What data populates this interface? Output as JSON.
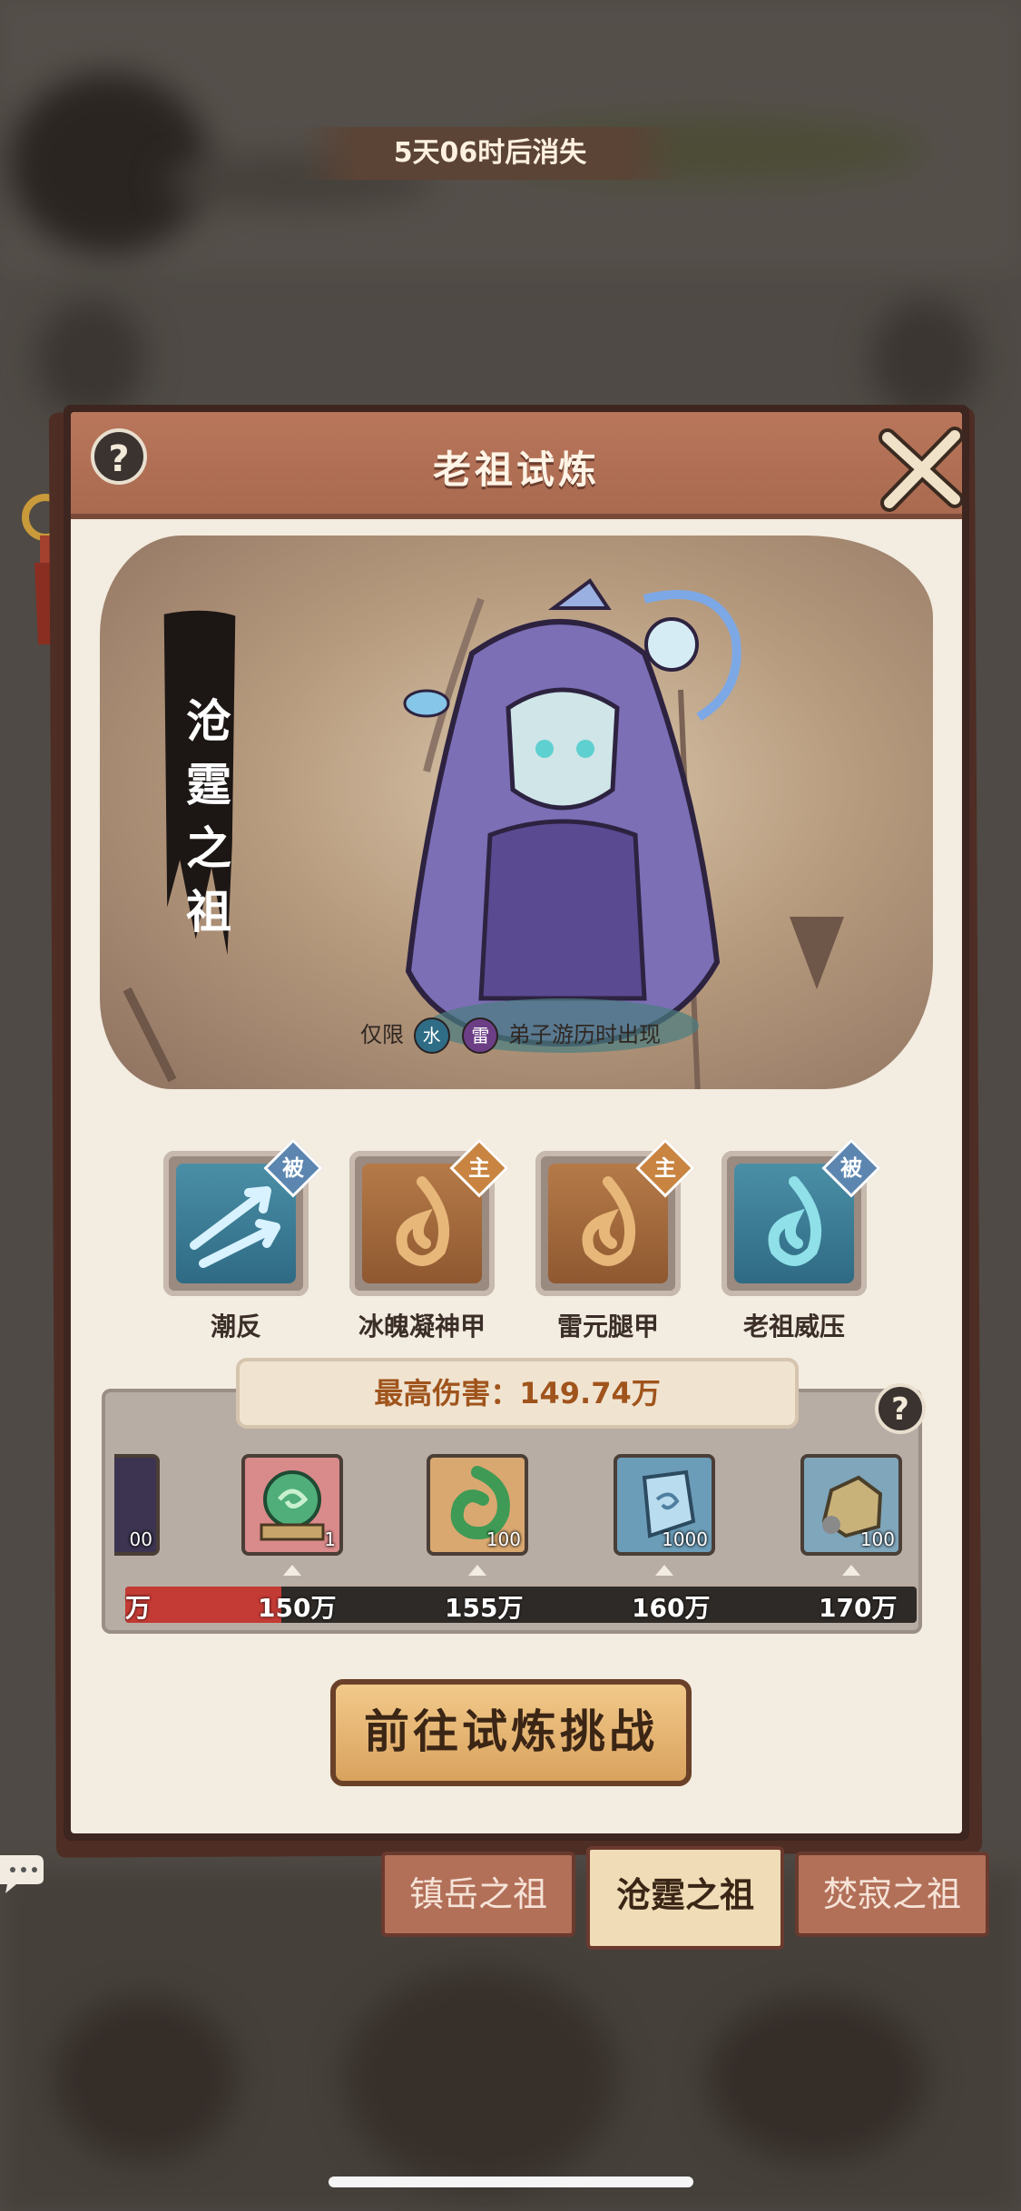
{
  "modal": {
    "title": "老祖试炼",
    "help_symbol": "?",
    "timer": "5天06时后消失",
    "boss_name": [
      "沧",
      "霆",
      "之",
      "祖"
    ],
    "restriction": {
      "prefix": "仅限",
      "element_water": "水",
      "element_thunder": "雷",
      "suffix": "弟子游历时出现"
    }
  },
  "skills": [
    {
      "label": "潮反",
      "tag": "被",
      "icon": "thunder-arrow-icon"
    },
    {
      "label": "冰魄凝神甲",
      "tag": "主",
      "icon": "flame-swirl-icon"
    },
    {
      "label": "雷元腿甲",
      "tag": "主",
      "icon": "flame-swirl-icon"
    },
    {
      "label": "老祖威压",
      "tag": "被",
      "icon": "water-swirl-icon"
    }
  ],
  "damage": {
    "label": "最高伤害：149.74万",
    "progress_fraction": 0.98,
    "partial_tick": "万",
    "rewards": [
      {
        "name": "jade-swirl-cushion",
        "count": "1",
        "tick": "150万"
      },
      {
        "name": "jade-serpent",
        "count": "100",
        "tick": "155万"
      },
      {
        "name": "spirit-crystal",
        "count": "1000",
        "tick": "160万"
      },
      {
        "name": "ore-stone",
        "count": "100",
        "tick": "170万"
      }
    ],
    "partial_reward_count": "00"
  },
  "challenge_button": "前往试炼挑战",
  "tabs": [
    {
      "label": "镇岳之祖",
      "active": false
    },
    {
      "label": "沧霆之祖",
      "active": true
    },
    {
      "label": "焚寂之祖",
      "active": false
    }
  ],
  "colors": {
    "header": "#b0705a",
    "panel_bg": "#f3ece0",
    "damage_text": "#a0541c",
    "bar_fill": "#c43a34",
    "element_water": "#2f6d86",
    "element_thunder": "#6b3e86"
  }
}
